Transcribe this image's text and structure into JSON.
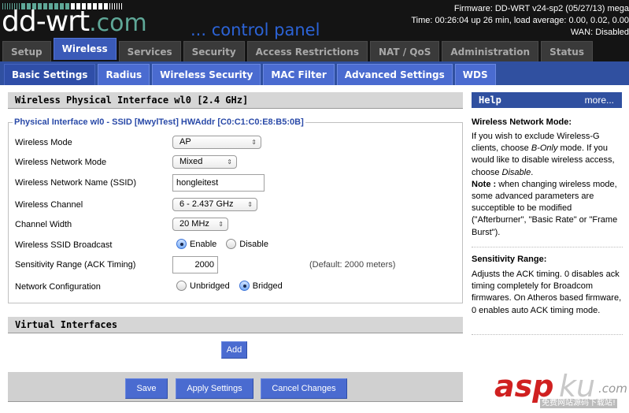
{
  "header": {
    "logo_main": "dd-wrt",
    "logo_domain": ".com",
    "tagline": "... control panel",
    "firmware": "Firmware: DD-WRT v24-sp2 (05/27/13) mega",
    "time": "Time: 00:26:04 up 26 min, load average: 0.00, 0.02, 0.00",
    "wan": "WAN: Disabled"
  },
  "main_tabs": [
    {
      "label": "Setup",
      "active": false
    },
    {
      "label": "Wireless",
      "active": true
    },
    {
      "label": "Services",
      "active": false
    },
    {
      "label": "Security",
      "active": false
    },
    {
      "label": "Access Restrictions",
      "active": false
    },
    {
      "label": "NAT / QoS",
      "active": false
    },
    {
      "label": "Administration",
      "active": false
    },
    {
      "label": "Status",
      "active": false
    }
  ],
  "sub_tabs": [
    {
      "label": "Basic Settings",
      "active": true
    },
    {
      "label": "Radius",
      "active": false
    },
    {
      "label": "Wireless Security",
      "active": false
    },
    {
      "label": "MAC Filter",
      "active": false
    },
    {
      "label": "Advanced Settings",
      "active": false
    },
    {
      "label": "WDS",
      "active": false
    }
  ],
  "physical": {
    "section_title": "Wireless Physical Interface wl0 [2.4 GHz]",
    "legend": "Physical Interface wl0 - SSID [MwylTest] HWAddr [C0:C1:C0:E8:B5:0B]",
    "fields": {
      "wireless_mode": {
        "label": "Wireless Mode",
        "value": "AP"
      },
      "network_mode": {
        "label": "Wireless Network Mode",
        "value": "Mixed"
      },
      "ssid": {
        "label": "Wireless Network Name (SSID)",
        "value": "hongleitest"
      },
      "channel": {
        "label": "Wireless Channel",
        "value": "6 - 2.437 GHz"
      },
      "channel_width": {
        "label": "Channel Width",
        "value": "20 MHz"
      },
      "ssid_broadcast": {
        "label": "Wireless SSID Broadcast",
        "options": [
          "Enable",
          "Disable"
        ],
        "selected": "Enable"
      },
      "sensitivity": {
        "label": "Sensitivity Range (ACK Timing)",
        "value": "2000",
        "hint": "(Default: 2000 meters)"
      },
      "network_config": {
        "label": "Network Configuration",
        "options": [
          "Unbridged",
          "Bridged"
        ],
        "selected": "Bridged"
      }
    }
  },
  "virtual": {
    "section_title": "Virtual Interfaces",
    "add_label": "Add"
  },
  "footer": {
    "save": "Save",
    "apply": "Apply Settings",
    "cancel": "Cancel Changes"
  },
  "help": {
    "title": "Help",
    "more": "more...",
    "topics": [
      {
        "heading": "Wireless Network Mode:",
        "text": "If you wish to exclude Wireless-G clients, choose B-Only mode. If you would like to disable wireless access, choose Disable.",
        "note_label": "Note :",
        "note": " when changing wireless mode, some advanced parameters are succeptible to be modified (\"Afterburner\", \"Basic Rate\" or \"Frame Burst\")."
      },
      {
        "heading": "Sensitivity Range:",
        "text": "Adjusts the ACK timing. 0 disables ack timing completely for Broadcom firmwares. On Atheros based firmware, 0 enables auto ACK timing mode."
      }
    ]
  },
  "watermark": {
    "brand_a": "asp",
    "brand_b": "ku",
    "domain": ".com",
    "slogan": "免费网站源码下载站!"
  },
  "colors": {
    "header_bg": "#141414",
    "tab_active": "#3a5ab8",
    "subtab": "#4a6bd0",
    "help_header": "#3050a0",
    "legend_text": "#2a4aa8",
    "tagline": "#2c63d6"
  }
}
